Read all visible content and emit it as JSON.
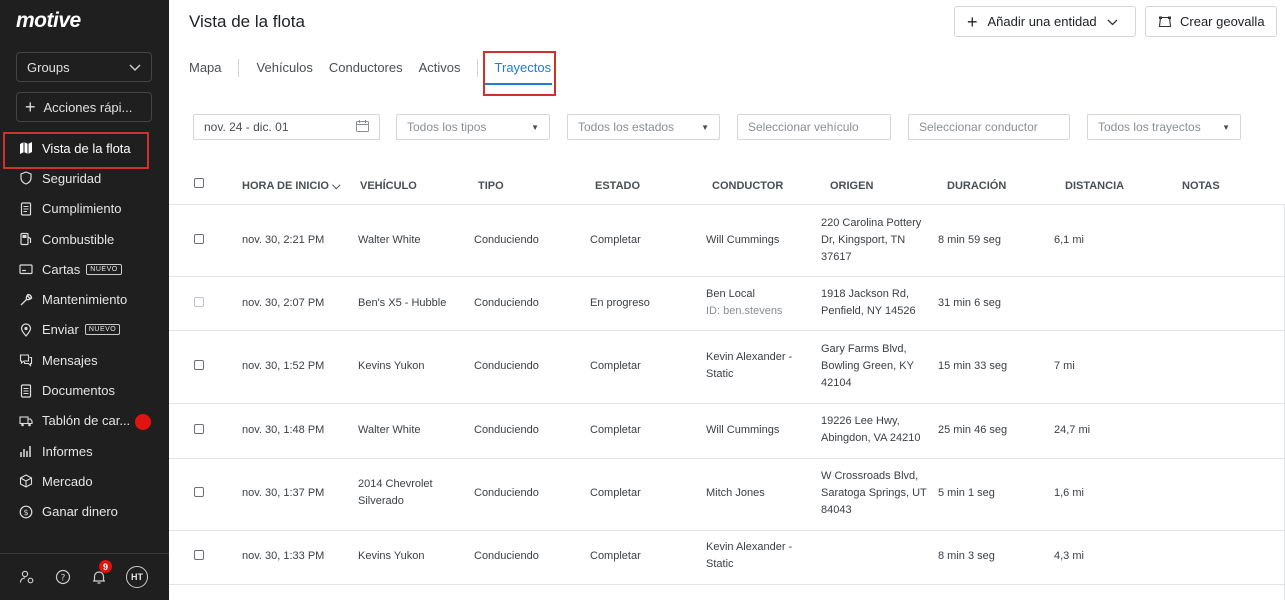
{
  "app": {
    "logo": "motive"
  },
  "sidebar": {
    "groups_label": "Groups",
    "quick_actions_label": "Acciones rápi...",
    "items": [
      {
        "label": "Vista de la flota",
        "icon": "map-icon",
        "active": true,
        "badge": ""
      },
      {
        "label": "Seguridad",
        "icon": "shield-icon",
        "badge": ""
      },
      {
        "label": "Cumplimiento",
        "icon": "document-icon",
        "badge": ""
      },
      {
        "label": "Combustible",
        "icon": "fuel-icon",
        "badge": ""
      },
      {
        "label": "Cartas",
        "icon": "card-icon",
        "badge": "NUEVO"
      },
      {
        "label": "Mantenimiento",
        "icon": "wrench-icon",
        "badge": ""
      },
      {
        "label": "Enviar",
        "icon": "location-icon",
        "badge": "NUEVO"
      },
      {
        "label": "Mensajes",
        "icon": "message-icon",
        "badge": ""
      },
      {
        "label": "Documentos",
        "icon": "documents-icon",
        "badge": ""
      },
      {
        "label": "Tablón de car...",
        "icon": "truck-icon",
        "badge": ""
      },
      {
        "label": "Informes",
        "icon": "chart-icon",
        "badge": ""
      },
      {
        "label": "Mercado",
        "icon": "cube-icon",
        "badge": ""
      },
      {
        "label": "Ganar dinero",
        "icon": "dollar-icon",
        "badge": ""
      }
    ],
    "notifications_count": "9",
    "avatar_initials": "HT"
  },
  "header": {
    "title": "Vista de la flota",
    "add_entity_label": "Añadir una entidad",
    "create_geofence_label": "Crear geovalla"
  },
  "tabs": [
    {
      "label": "Mapa"
    },
    {
      "label": "Vehículos"
    },
    {
      "label": "Conductores"
    },
    {
      "label": "Activos"
    },
    {
      "label": "Trayectos",
      "active": true
    }
  ],
  "filters": {
    "date_range": "nov. 24 - dic. 01",
    "types_placeholder": "Todos los tipos",
    "states_placeholder": "Todos los estados",
    "vehicle_placeholder": "Seleccionar vehículo",
    "driver_placeholder": "Seleccionar conductor",
    "trips_placeholder": "Todos los trayectos"
  },
  "table": {
    "columns": {
      "start_time": "HORA DE INICIO",
      "vehicle": "VEHÍCULO",
      "type": "TIPO",
      "status": "ESTADO",
      "driver": "CONDUCTOR",
      "origin": "ORIGEN",
      "duration": "DURACIÓN",
      "distance": "DISTANCIA",
      "notes": "NOTAS"
    },
    "rows": [
      {
        "start": "nov. 30, 2:21 PM",
        "vehicle1": "Walter White",
        "vehicle2": "",
        "type": "Conduciendo",
        "status": "Completar",
        "driver1": "Will Cummings",
        "driver2": "",
        "origin1": "220 Carolina Pottery",
        "origin2": "Dr, Kingsport, TN",
        "origin3": "37617",
        "duration": "8 min 59 seg",
        "distance": "6,1 mi"
      },
      {
        "start": "nov. 30, 2:07 PM",
        "vehicle1": "Ben's X5 - Hubble",
        "vehicle2": "",
        "type": "Conduciendo",
        "status": "En progreso",
        "driver1": "Ben Local",
        "driver2": "ID: ben.stevens",
        "origin1": "1918 Jackson Rd,",
        "origin2": "Penfield, NY 14526",
        "origin3": "",
        "duration": "31 min 6 seg",
        "distance": ""
      },
      {
        "start": "nov. 30, 1:52 PM",
        "vehicle1": "Kevins Yukon",
        "vehicle2": "",
        "type": "Conduciendo",
        "status": "Completar",
        "driver1": "Kevin Alexander -",
        "driver2": "Static",
        "origin1": "Gary Farms Blvd,",
        "origin2": "Bowling Green, KY",
        "origin3": "42104",
        "duration": "15 min 33 seg",
        "distance": "7 mi"
      },
      {
        "start": "nov. 30, 1:48 PM",
        "vehicle1": "Walter White",
        "vehicle2": "",
        "type": "Conduciendo",
        "status": "Completar",
        "driver1": "Will Cummings",
        "driver2": "",
        "origin1": "19226 Lee Hwy,",
        "origin2": "Abingdon, VA 24210",
        "origin3": "",
        "duration": "25 min 46 seg",
        "distance": "24,7 mi"
      },
      {
        "start": "nov. 30, 1:37 PM",
        "vehicle1": "2014 Chevrolet",
        "vehicle2": "Silverado",
        "type": "Conduciendo",
        "status": "Completar",
        "driver1": "Mitch Jones",
        "driver2": "",
        "origin1": "W Crossroads Blvd,",
        "origin2": "Saratoga Springs, UT",
        "origin3": "84043",
        "duration": "5 min 1 seg",
        "distance": "1,6 mi"
      },
      {
        "start": "nov. 30, 1:33 PM",
        "vehicle1": "Kevins Yukon",
        "vehicle2": "",
        "type": "Conduciendo",
        "status": "Completar",
        "driver1": "Kevin Alexander -",
        "driver2": "Static",
        "origin1": "",
        "origin2": "",
        "origin3": "",
        "duration": "8 min 3 seg",
        "distance": "4,3 mi"
      }
    ]
  }
}
